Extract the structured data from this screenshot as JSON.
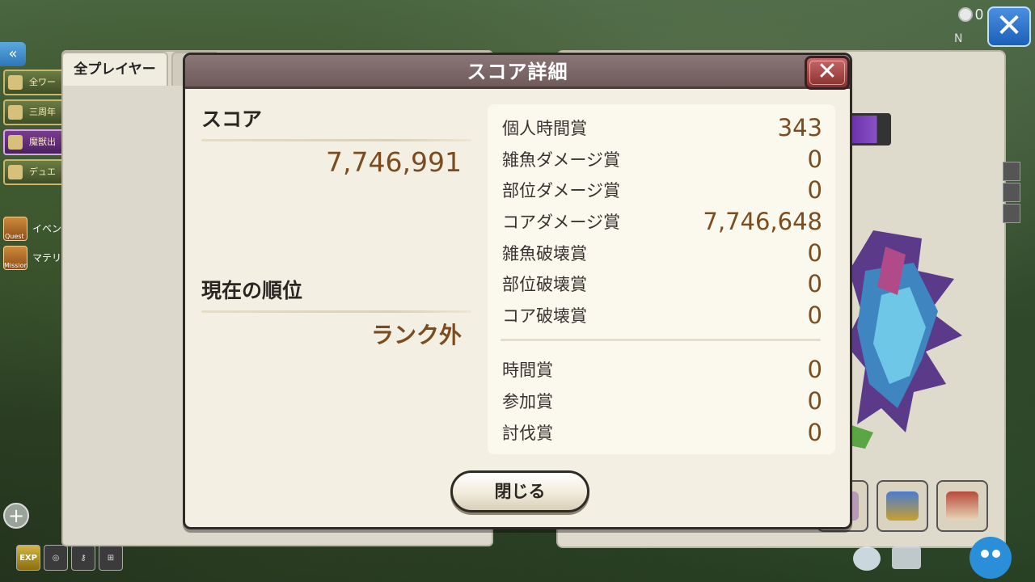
{
  "hud": {
    "clock_count": "0",
    "close_glyph": "✕",
    "compass": "N",
    "back_glyph": "«"
  },
  "left_rail": {
    "items": [
      {
        "label": "全ワー",
        "icon": "world-icon"
      },
      {
        "label": "三周年",
        "icon": "anniversary-icon"
      },
      {
        "label": "魔獣出",
        "icon": "beast-icon",
        "active": true
      },
      {
        "label": "デュエ",
        "icon": "duel-icon"
      }
    ],
    "quest_label": "イベン",
    "quest_tag": "Quest",
    "mission_label": "マテリ",
    "mission_tag": "Mission",
    "plus_glyph": "+",
    "bottom": [
      "EXP",
      "◎",
      "⚷",
      "⊞"
    ]
  },
  "background_panel": {
    "tab_all_players": "全プレイヤー"
  },
  "modal": {
    "title": "スコア詳細",
    "close_glyph": "✕",
    "score_label": "スコア",
    "score_value": "7,746,991",
    "rank_label": "現在の順位",
    "rank_value": "ランク外",
    "breakdown_top": [
      {
        "label": "個人時間賞",
        "value": "343"
      },
      {
        "label": "雑魚ダメージ賞",
        "value": "0"
      },
      {
        "label": "部位ダメージ賞",
        "value": "0"
      },
      {
        "label": "コアダメージ賞",
        "value": "7,746,648"
      },
      {
        "label": "雑魚破壊賞",
        "value": "0"
      },
      {
        "label": "部位破壊賞",
        "value": "0"
      },
      {
        "label": "コア破壊賞",
        "value": "0"
      }
    ],
    "breakdown_bottom": [
      {
        "label": "時間賞",
        "value": "0"
      },
      {
        "label": "参加賞",
        "value": "0"
      },
      {
        "label": "討伐賞",
        "value": "0"
      }
    ],
    "close_button": "閉じる"
  },
  "colors": {
    "header": "#7d6869",
    "value_text": "#7a4c1f",
    "panel_bg": "#f3efe3",
    "card_bg": "#fbf8ee",
    "close_red": "#a94444",
    "hud_blue": "#2f76c8"
  }
}
